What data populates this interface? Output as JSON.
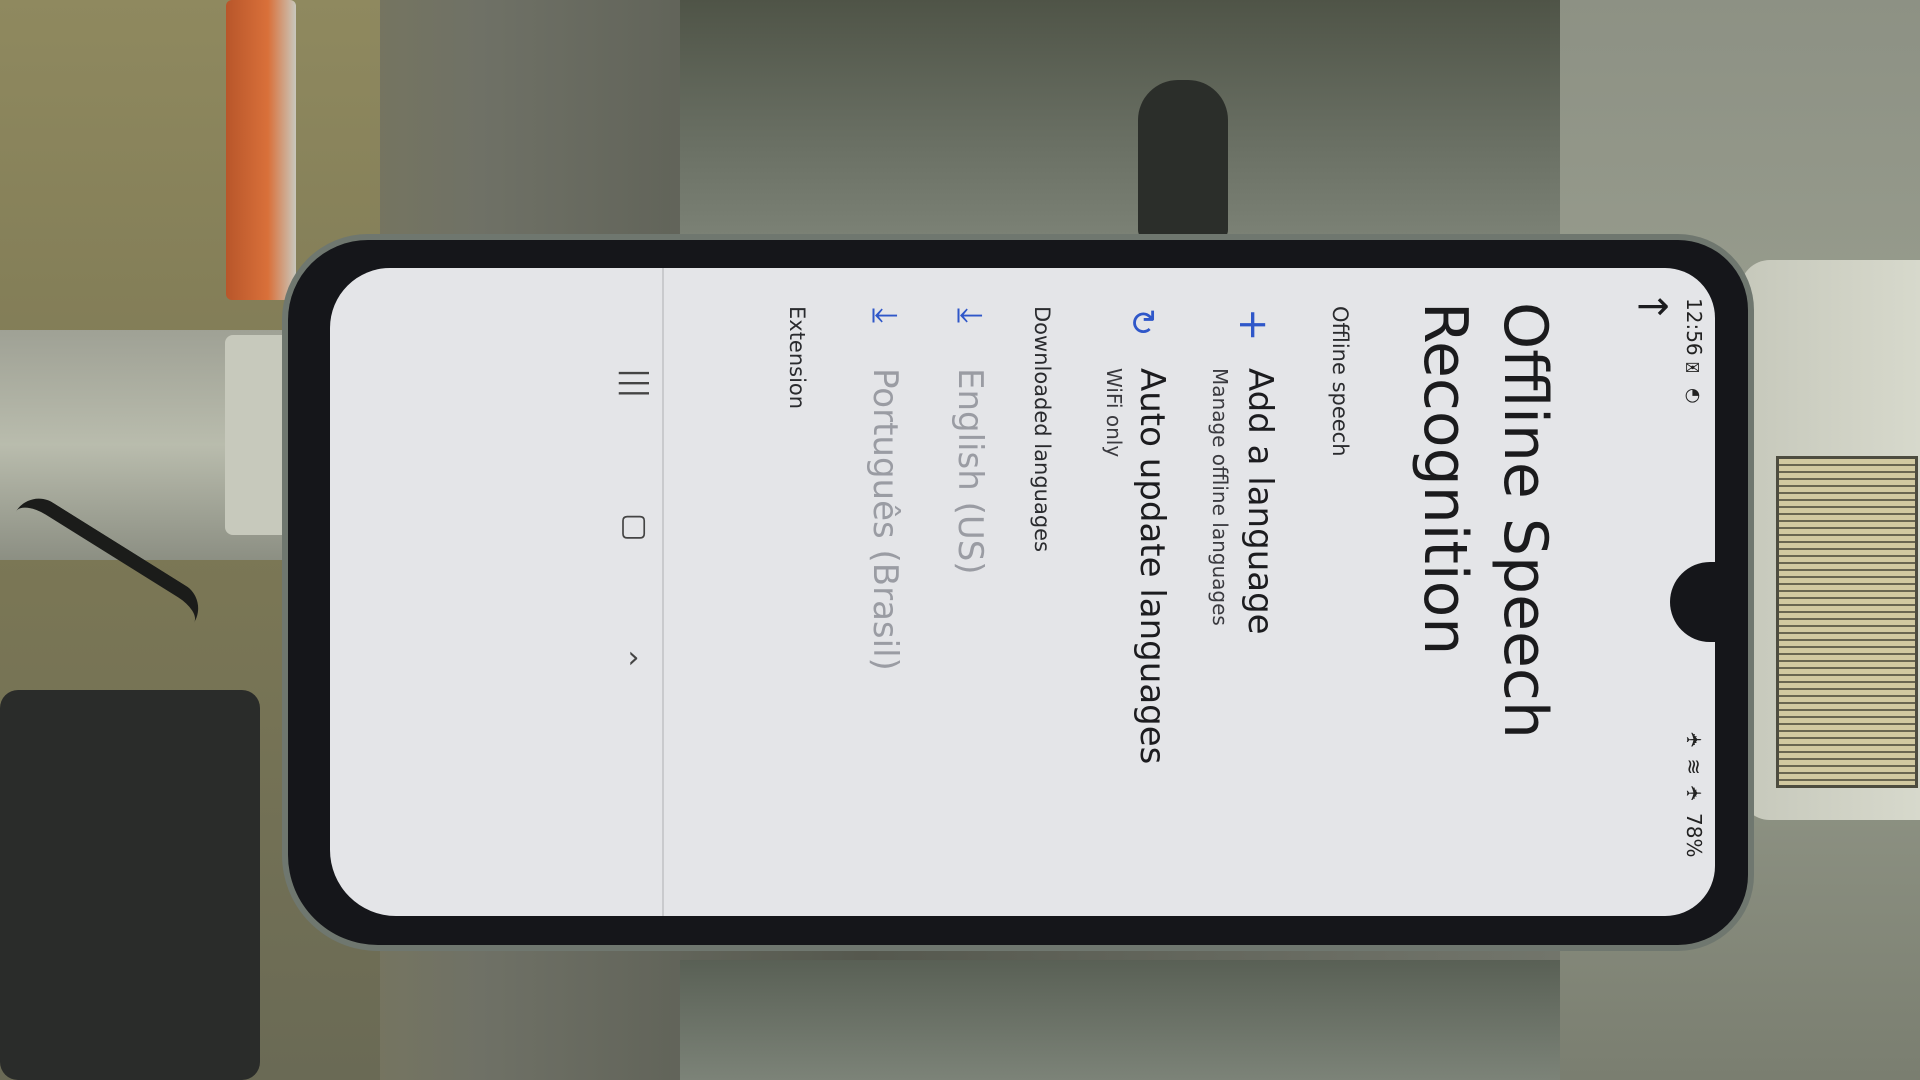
{
  "status_bar": {
    "time": "12:56",
    "battery": "78%"
  },
  "header": {
    "back_icon": "arrow-back-icon",
    "title_line1": "Offline Speech",
    "title_line2": "Recognition"
  },
  "sections": {
    "offline_speech": "Offline speech",
    "downloaded_languages": "Downloaded languages",
    "extension": "Extension"
  },
  "items": {
    "add_language": {
      "icon": "plus-icon",
      "title": "Add a language",
      "subtitle": "Manage offline languages"
    },
    "auto_update": {
      "icon": "refresh-icon",
      "title": "Auto update languages",
      "subtitle": "WiFi only"
    },
    "languages": [
      {
        "icon": "download-icon",
        "label": "English (US)"
      },
      {
        "icon": "download-icon",
        "label": "Português (Brasil)"
      }
    ]
  },
  "navigation_bar": {
    "recents_icon": "recents-icon",
    "home_icon": "home-icon",
    "back_icon": "chevron-back-icon"
  },
  "colors": {
    "accent": "#2f57c9",
    "screen_background": "#e4e5e8",
    "text_primary": "#1c1c1f",
    "text_disabled": "#9a9ca3"
  }
}
